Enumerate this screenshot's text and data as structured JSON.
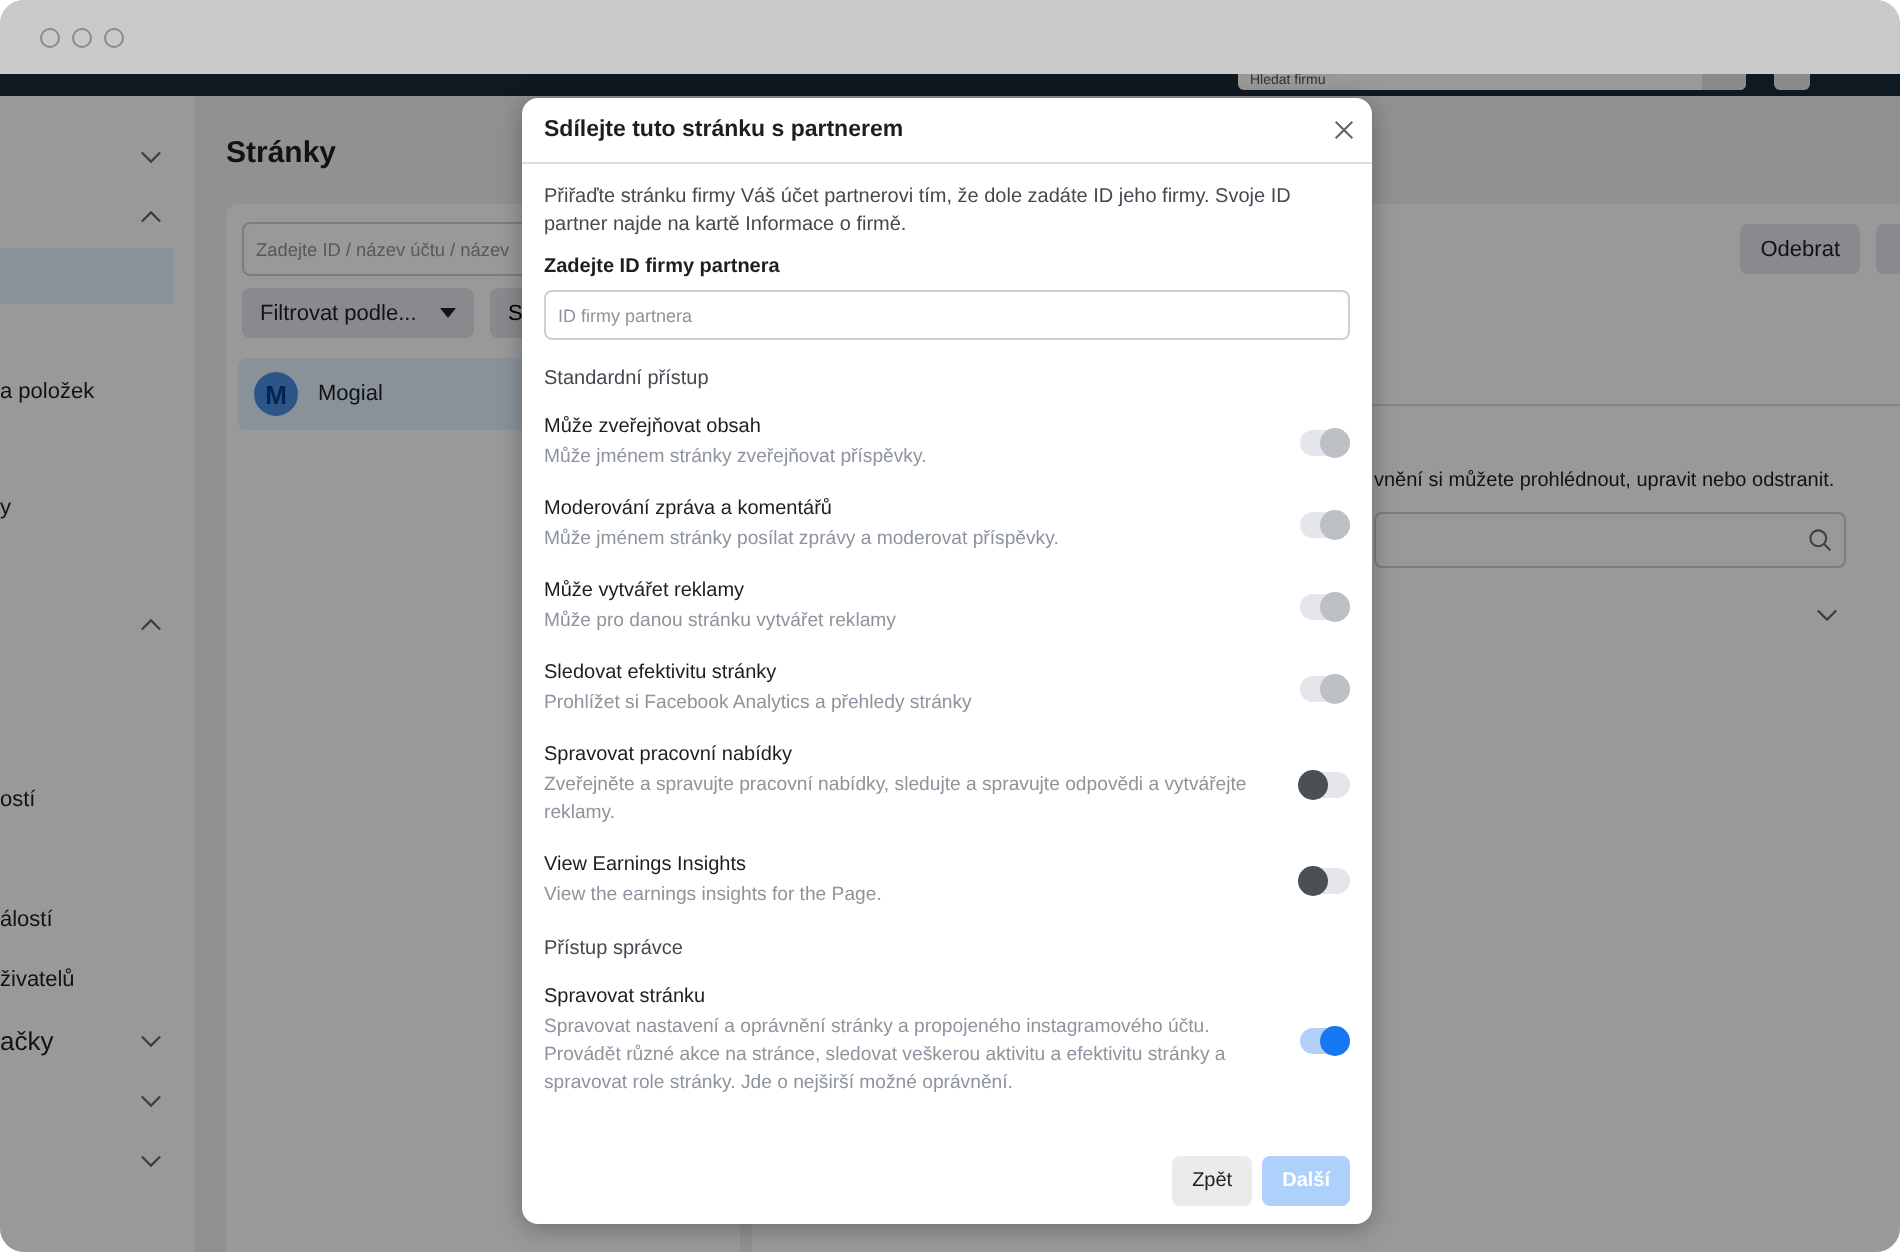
{
  "topbar": {
    "search_placeholder": "Hledat firmu"
  },
  "sidebar": {
    "items": [
      {
        "kind": "header",
        "expanded": false
      },
      {
        "kind": "header",
        "expanded": true
      },
      {
        "kind": "item",
        "selected": true
      },
      {
        "kind": "item",
        "label": "a položek",
        "selected": false
      },
      {
        "kind": "item",
        "label": "y",
        "selected": false
      },
      {
        "kind": "header",
        "expanded": true
      },
      {
        "kind": "item",
        "label": "ostí",
        "selected": false
      },
      {
        "kind": "item",
        "label": "álostí",
        "selected": false
      },
      {
        "kind": "item",
        "label": "živatelů",
        "selected": false
      },
      {
        "kind": "header",
        "label": "ačky",
        "expanded": false
      },
      {
        "kind": "header",
        "expanded": false
      },
      {
        "kind": "header",
        "expanded": false
      }
    ]
  },
  "page_title": "Stránky",
  "list_panel": {
    "search_placeholder": "Zadejte ID / název účtu / název",
    "filter": "Filtrovat podle...",
    "second_button": "S",
    "rows": [
      {
        "avatar_letter": "M",
        "name": "Mogial",
        "selected": true
      }
    ]
  },
  "detail_panel": {
    "remove_button": "Odebrat",
    "info_text": "vnění si můžete prohlédnout, upravit nebo odstranit."
  },
  "dialog": {
    "title": "Sdílejte tuto stránku s partnerem",
    "description": "Přiřaďte stránku firmy Váš účet partnerovi tím, že dole zadáte ID jeho firmy. Svoje ID partner najde na kartě Informace o firmě.",
    "field_label": "Zadejte ID firmy partnera",
    "field_placeholder": "ID firmy partnera",
    "sections": [
      {
        "heading": "Standardní přístup",
        "permissions": [
          {
            "title": "Může zveřejňovat obsah",
            "description": "Může jménem stránky zveřejňovat příspěvky.",
            "on": true,
            "disabled": true
          },
          {
            "title": "Moderování zpráva a komentářů",
            "description": "Může jménem stránky posílat zprávy a moderovat příspěvky.",
            "on": true,
            "disabled": true
          },
          {
            "title": "Může vytvářet reklamy",
            "description": "Může pro danou stránku vytvářet reklamy",
            "on": true,
            "disabled": true
          },
          {
            "title": "Sledovat efektivitu stránky",
            "description": "Prohlížet si Facebook Analytics a přehledy stránky",
            "on": true,
            "disabled": true
          },
          {
            "title": "Spravovat pracovní nabídky",
            "description": "Zveřejněte a spravujte pracovní nabídky, sledujte a spravujte odpovědi a vytvářejte reklamy.",
            "on": false,
            "disabled": false
          },
          {
            "title": "View Earnings Insights",
            "description": "View the earnings insights for the Page.",
            "on": false,
            "disabled": false
          }
        ]
      },
      {
        "heading": "Přístup správce",
        "permissions": [
          {
            "title": "Spravovat stránku",
            "description": "Spravovat nastavení a oprávnění stránky a propojeného instagramového účtu. Provádět různé akce na stránce, sledovat veškerou aktivitu a efektivitu stránky a spravovat role stránky. Jde o nejširší možné oprávnění.",
            "on": true,
            "disabled": false
          }
        ]
      }
    ],
    "buttons": [
      {
        "label": "Zpět",
        "kind": "secondary",
        "disabled": false
      },
      {
        "label": "Další",
        "kind": "primary",
        "disabled": true
      }
    ]
  }
}
